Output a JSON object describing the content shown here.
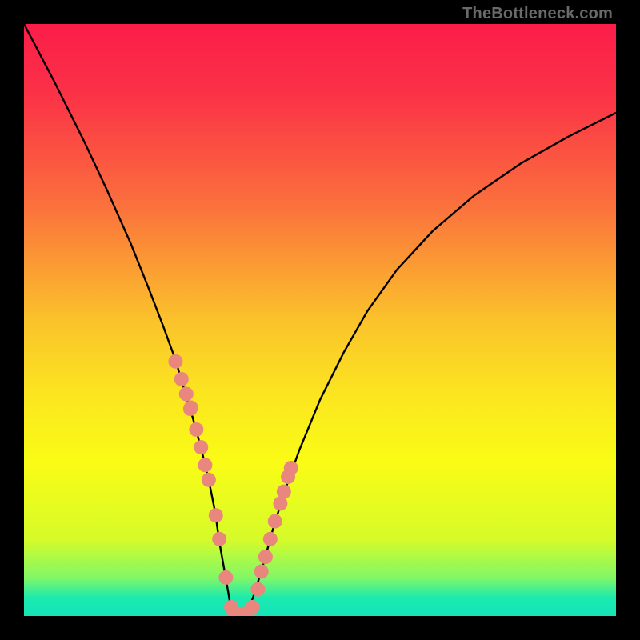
{
  "watermark": "TheBottleneck.com",
  "colors": {
    "frame": "#000000",
    "curve_stroke": "#000000",
    "dot_fill": "#e9877f",
    "gradient_stops": [
      {
        "offset": 0.0,
        "color": "#fb1d49"
      },
      {
        "offset": 0.12,
        "color": "#fb3247"
      },
      {
        "offset": 0.3,
        "color": "#fb6e3d"
      },
      {
        "offset": 0.5,
        "color": "#fbc22b"
      },
      {
        "offset": 0.62,
        "color": "#fbe420"
      },
      {
        "offset": 0.74,
        "color": "#fafc15"
      },
      {
        "offset": 0.87,
        "color": "#d6fb29"
      },
      {
        "offset": 0.935,
        "color": "#82f765"
      },
      {
        "offset": 0.97,
        "color": "#1aeab0"
      },
      {
        "offset": 1.0,
        "color": "#15e4b8"
      }
    ]
  },
  "chart_data": {
    "type": "line",
    "title": "",
    "xlabel": "",
    "ylabel": "",
    "xlim": [
      0,
      100
    ],
    "ylim": [
      0,
      100
    ],
    "series": [
      {
        "name": "bottleneck-curve",
        "x": [
          0,
          5,
          10,
          14,
          18,
          21,
          23.5,
          25.5,
          27,
          28.5,
          30,
          31.3,
          32.3,
          33,
          33.8,
          34.5,
          35,
          36,
          37,
          38,
          39,
          40.5,
          42,
          44,
          46.5,
          50,
          54,
          58,
          63,
          69,
          76,
          84,
          92,
          100
        ],
        "y": [
          100,
          90.5,
          80.5,
          72,
          63,
          55.5,
          49,
          43.5,
          38.5,
          33.5,
          28,
          22.5,
          17.5,
          12.5,
          8,
          4,
          1,
          0.3,
          0.3,
          1.3,
          4,
          9,
          14.5,
          21,
          28,
          36.5,
          44.5,
          51.5,
          58.5,
          65,
          71,
          76.5,
          81,
          85
        ]
      }
    ],
    "dots": {
      "name": "highlight-dots",
      "x": [
        25.6,
        26.6,
        27.4,
        28.1,
        28.2,
        29.1,
        29.9,
        30.6,
        31.2,
        32.4,
        33.0,
        34.1,
        35.0,
        35.5,
        36.2,
        37.0,
        37.8,
        38.6,
        39.5,
        40.1,
        40.8,
        41.6,
        42.4,
        43.3,
        43.9,
        44.6,
        45.1
      ],
      "y": [
        43.0,
        40.0,
        37.5,
        35.0,
        35.2,
        31.5,
        28.5,
        25.5,
        23.0,
        17.0,
        13.0,
        6.5,
        1.5,
        0.4,
        0.3,
        0.3,
        0.5,
        1.5,
        4.5,
        7.5,
        10.0,
        13.0,
        16.0,
        19.0,
        21.0,
        23.5,
        25.0
      ]
    }
  }
}
